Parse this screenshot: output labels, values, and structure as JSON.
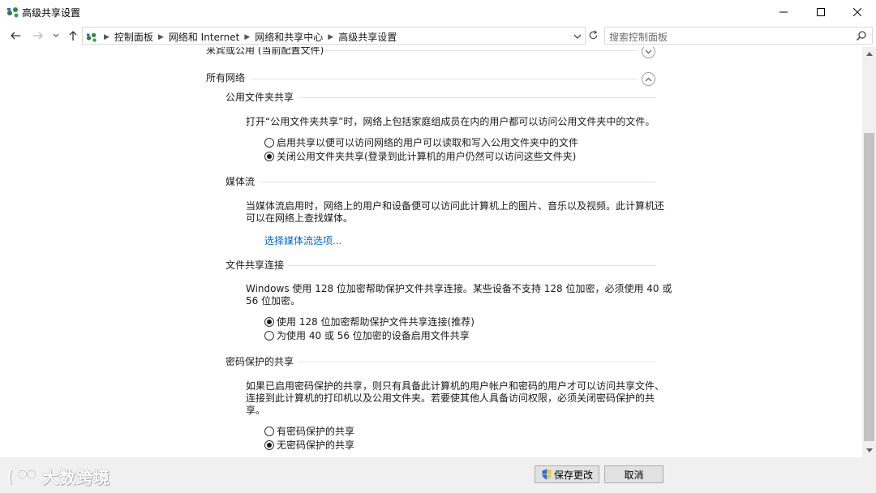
{
  "window": {
    "title": "高级共享设置"
  },
  "address": {
    "breadcrumbs": [
      "控制面板",
      "网络和 Internet",
      "网络和共享中心",
      "高级共享设置"
    ]
  },
  "search": {
    "placeholder": "搜索控制面板"
  },
  "sections": {
    "cut_top": "来宾或公用 (当前配置文件)",
    "all_networks": "所有网络",
    "public_folder": {
      "title": "公用文件夹共享",
      "desc": "打开“公用文件夹共享”时，网络上包括家庭组成员在内的用户都可以访问公用文件夹中的文件。",
      "options": [
        {
          "label": "启用共享以便可以访问网络的用户可以读取和写入公用文件夹中的文件",
          "checked": false
        },
        {
          "label": "关闭公用文件夹共享(登录到此计算机的用户仍然可以访问这些文件夹)",
          "checked": true
        }
      ]
    },
    "media": {
      "title": "媒体流",
      "desc_line1": "当媒体流启用时，网络上的用户和设备便可以访问此计算机上的图片、音乐以及视频。此计算机还",
      "desc_line2": "可以在网络上查找媒体。",
      "link": "选择媒体流选项..."
    },
    "file_conn": {
      "title": "文件共享连接",
      "desc_line1": "Windows 使用 128 位加密帮助保护文件共享连接。某些设备不支持 128 位加密，必须使用 40 或",
      "desc_line2": "56 位加密。",
      "options": [
        {
          "label": "使用 128 位加密帮助保护文件共享连接(推荐)",
          "checked": true
        },
        {
          "label": "为使用 40 或 56 位加密的设备启用文件共享",
          "checked": false
        }
      ]
    },
    "password": {
      "title": "密码保护的共享",
      "desc_line1": "如果已启用密码保护的共享，则只有具备此计算机的用户帐户和密码的用户才可以访问共享文件、",
      "desc_line2": "连接到此计算机的打印机以及公用文件夹。若要使其他人具备访问权限，必须关闭密码保护的共",
      "desc_line3": "享。",
      "options": [
        {
          "label": "有密码保护的共享",
          "checked": false
        },
        {
          "label": "无密码保护的共享",
          "checked": true
        }
      ]
    }
  },
  "footer": {
    "save_label": "保存更改",
    "cancel_label": "取消",
    "watermark": "大数跨境"
  },
  "colors": {
    "link": "#0066cc",
    "footer_bg": "#f0f0f0"
  }
}
